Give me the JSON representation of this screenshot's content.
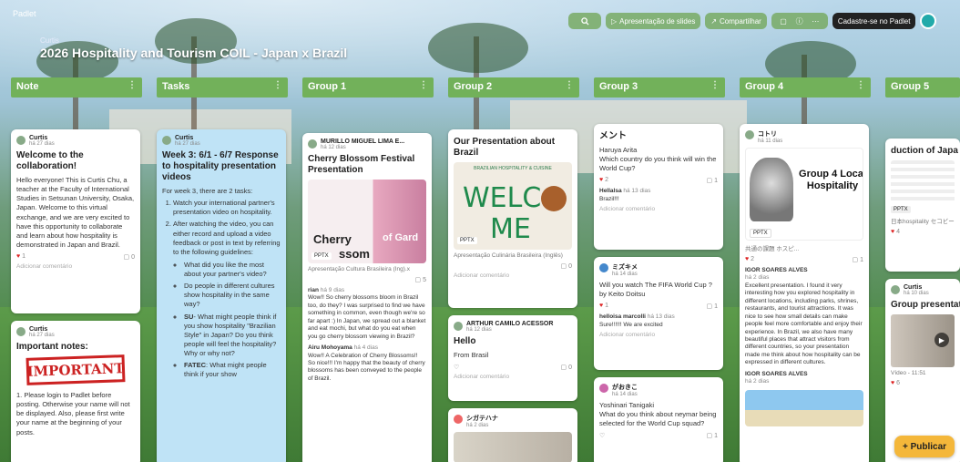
{
  "app": {
    "name": "Padlet",
    "crumb": "Curtis",
    "board_title": "2026 Hospitality and Tourism COIL - Japan x Brazil"
  },
  "toolbar": {
    "search_icon": "search-icon",
    "slideshow_label": "Apresentação de slides",
    "share_label": "Compartilhar",
    "signup_label": "Cadastre-se no Padlet"
  },
  "columns": [
    {
      "title": "Note"
    },
    {
      "title": "Tasks"
    },
    {
      "title": "Group 1"
    },
    {
      "title": "Group 2"
    },
    {
      "title": "Group 3"
    },
    {
      "title": "Group 4"
    },
    {
      "title": "Group 5"
    }
  ],
  "note": {
    "card1": {
      "author": "Curtis",
      "time": "há 27 dias",
      "title": "Welcome to the collaboration!",
      "body": "Hello everyone! This is Curtis Chu, a teacher at the Faculty of International Studies in Setsunan University, Osaka, Japan. Welcome to this virtual exchange, and we are very excited to have this opportunity to collaborate and learn about how hospitality is demonstrated in Japan and Brazil.",
      "likes": "1",
      "comments": "0",
      "add_comment": "Adicionar comentário"
    },
    "card2": {
      "author": "Curtis",
      "time": "há 27 dias",
      "title": "Important notes:",
      "stamp": "IMPORTANT",
      "body": "1. Please login to Padlet before posting. Otherwise your name will not be displayed. Also, please first write your name at the beginning of your posts."
    }
  },
  "tasks": {
    "card1": {
      "author": "Curtis",
      "time": "há 27 dias",
      "title": "Week 3: 6/1 - 6/7 Response to hospitality presentation videos",
      "intro": "For week 3, there are 2 tasks:",
      "step1": "Watch your international partner's presentation video on hospitality.",
      "step2": "After watching the video, you can either record and upload a video feedback or post in text by referring to the following guidelines:",
      "q1": "What did you like the most about your partner's video?",
      "q2": "Do people in different cultures show hospitality in the same way?",
      "q3_label": "SU",
      "q3": "- What might people think if you show hospitality \"Brazilian Style\" in Japan? Do you think people will feel the hospitality? Why or why not?",
      "q4_label": "FATEC",
      "q4": ": What might people think if your show"
    }
  },
  "group1": {
    "card1": {
      "author": "MURILLO MIGUEL LIMA E...",
      "time": "há 12 dias",
      "title": "Cherry Blossom Festival Presentation",
      "img_text1": "Cherry",
      "img_text2": "ssom",
      "img_text3": "of Gard",
      "badge": "PPTX",
      "caption": "Apresentação Cultura Brasileira (Ing).x",
      "comments": "5",
      "c1_name": "rian",
      "c1_time": "há 9 dias",
      "c1_text": "Wow!! So cherry blossoms bloom in Brazil too, do they? I was surprised to find we have something in common, even though we're so far apart :) In Japan, we spread out a blanket and eat mochi, but what do you eat when you go cherry blossom viewing in Brazil?",
      "c2_name": "Airu Mohoyama",
      "c2_time": "há 4 dias",
      "c2_text": "Wow!! A Celebration of Cherry Blossoms!! So nice!!! I'm happy that the beauty of cherry blossoms has been conveyed to the people of Brazil."
    }
  },
  "group2": {
    "card1": {
      "title": "Our Presentation about Brazil",
      "img_text1": "WELC",
      "img_text2": "ME",
      "img_sub": "BRAZILIAN HOSPITALITY & CUISINE",
      "badge": "PPTX",
      "caption": "Apresentação Culinária Brasileira (Inglês)",
      "comments": "0",
      "add_comment": "Adicionar comentário"
    },
    "card2": {
      "author": "ARTHUR CAMILO ACESSOR",
      "time": "há 12 dias",
      "title": "Hello",
      "body": "From Brasil",
      "comments": "0",
      "add_comment": "Adicionar comentário"
    },
    "card3": {
      "author": "シガテハナ",
      "time": "há 2 dias"
    }
  },
  "group3": {
    "card1": {
      "title": "メント",
      "author": "Haruya Arita",
      "body": "Which country do you think will win the World Cup?",
      "likes": "2",
      "comments": "1",
      "c1_name": "Hellalsa",
      "c1_time": "há 13 dias",
      "c1_text": "Brazil!!!",
      "add_comment": "Adicionar comentário"
    },
    "card2": {
      "author": "ミズキメ",
      "time": "há 14 dias",
      "body": "Will you watch The FIFA World Cup ? by Keito Doitsu",
      "likes": "1",
      "comments": "1",
      "c1_name": "helloisa marcolli",
      "c1_time": "há 13 dias",
      "c1_text": "Sure!!!!!! We are excited",
      "add_comment": "Adicionar comentário"
    },
    "card3": {
      "author": "がおきこ",
      "time": "há 14 dias",
      "title": "Yoshinari Tanigaki",
      "body": "What do you think about neymar being selected for the World Cup squad?",
      "comments": "1"
    }
  },
  "group4": {
    "card1": {
      "author": "コトリ",
      "time": "há 11 dias",
      "poster_title": "Group 4 Local Hospitality",
      "badge": "PPTX",
      "caption": "共通の課題 ホスピ...",
      "likes": "2",
      "comments": "1",
      "c1_name": "IGOR SOARES ALVES",
      "c1_time": "há 2 dias",
      "c1_text": "Excellent presentation. I found it very interesting how you explored hospitality in different locations, including parks, shrines, restaurants, and tourist attractions. It was nice to see how small details can make people feel more comfortable and enjoy their experience. In Brazil, we also have many beautiful places that attract visitors from different countries, so your presentation made me think about how hospitality can be expressed in different cultures.",
      "c2_name": "IGOR SOARES ALVES",
      "c2_time": "há 2 dias"
    }
  },
  "group5": {
    "card1": {
      "img_title": "duction of Japa",
      "badge": "PPTX",
      "caption": "日本hospitality セコビー",
      "likes": "4"
    },
    "card2": {
      "author": "Curtis",
      "time": "há 10 dias",
      "title": "Group presentat",
      "caption": "Vídeo - 11:51",
      "likes": "6"
    }
  },
  "publish_label": "+ Publicar"
}
